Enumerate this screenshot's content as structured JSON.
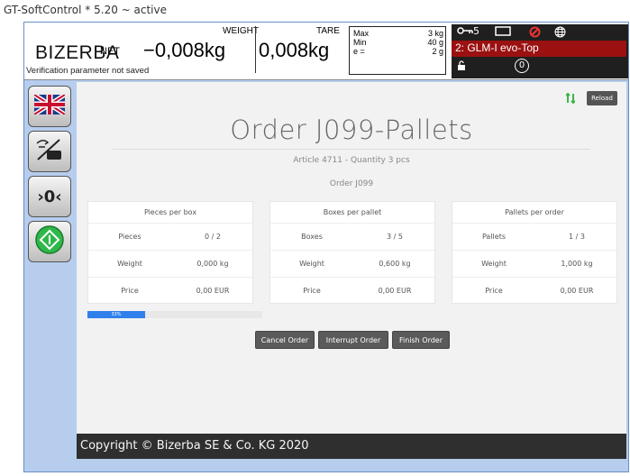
{
  "window": {
    "title": "GT-SoftControl * 5.20 ~ active"
  },
  "scale": {
    "brand": "BIZERBA",
    "net_label": "NET",
    "weight_label": "WEIGHT",
    "weight_value": "−0,008kg",
    "tare_label": "TARE",
    "tare_value": "0,008kg",
    "verification_note": "Verification parameter not saved",
    "spec": {
      "max_label": "Max",
      "max_value": "3 kg",
      "min_label": "Min",
      "min_value": "40 g",
      "e_label": "e =",
      "e_value": "2 g"
    },
    "status": {
      "key_count": "5",
      "device": "2: GLM-I evo-Top",
      "zero_symbol": "0"
    }
  },
  "sidebar": {
    "zero_label": "›0‹"
  },
  "main": {
    "reload_label": "Reload",
    "title": "Order J099-Pallets",
    "subtitle": "Article 4711 - Quantity 3 pcs",
    "order_line": "Order J099",
    "cards": [
      {
        "header": "Pieces per box",
        "rows": [
          {
            "label": "Pieces",
            "value": "0 / 2"
          },
          {
            "label": "Weight",
            "value": "0,000 kg"
          },
          {
            "label": "Price",
            "value": "0,00 EUR"
          }
        ]
      },
      {
        "header": "Boxes per pallet",
        "rows": [
          {
            "label": "Boxes",
            "value": "3 / 5"
          },
          {
            "label": "Weight",
            "value": "0,600 kg"
          },
          {
            "label": "Price",
            "value": "0,00 EUR"
          }
        ]
      },
      {
        "header": "Pallets per order",
        "rows": [
          {
            "label": "Pallets",
            "value": "1 / 3"
          },
          {
            "label": "Weight",
            "value": "1,000 kg"
          },
          {
            "label": "Price",
            "value": "0,00 EUR"
          }
        ]
      }
    ],
    "progress": {
      "value": 0.33,
      "label": "33%"
    },
    "buttons": {
      "cancel": "Cancel Order",
      "interrupt": "Interrupt Order",
      "finish": "Finish Order"
    }
  },
  "footer": {
    "copyright": "Copyright © Bizerba SE & Co. KG 2020"
  },
  "colors": {
    "frame_bg": "#b6cdee",
    "status_red": "#9b1010",
    "progress_blue": "#2f80ed",
    "footer_bg": "#2f2f2f"
  },
  "icons": [
    "flag-uk-icon",
    "tare-hand-icon",
    "zero-icon",
    "start-icon",
    "key-icon",
    "rectangle-icon",
    "prohibited-icon",
    "globe-icon",
    "unlock-icon",
    "green-arrows-icon"
  ]
}
